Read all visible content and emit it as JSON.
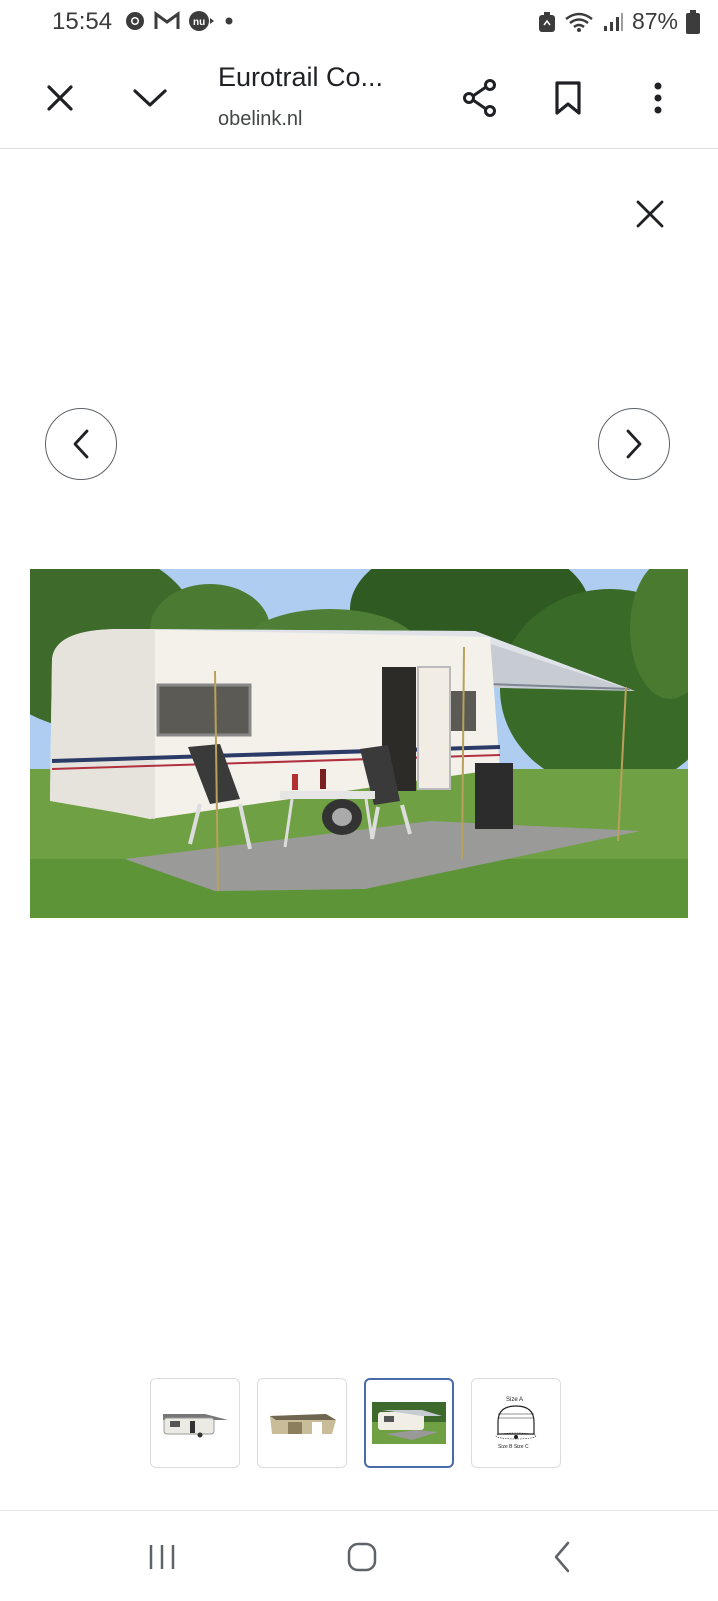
{
  "status_bar": {
    "time": "15:54",
    "battery": "87%",
    "icons_left": [
      "chrome-icon",
      "gmail-icon",
      "nu-icon",
      "dot-icon"
    ],
    "icons_right": [
      "recycle-icon",
      "wifi-icon",
      "signal-icon",
      "battery-icon"
    ]
  },
  "toolbar": {
    "title": "Eurotrail Co...",
    "domain": "obelink.nl",
    "icons": [
      "close-icon",
      "chevron-down-icon",
      "share-icon",
      "bookmark-icon",
      "more-vert-icon"
    ]
  },
  "viewer": {
    "main_image_alt": "Caravan with awning on grass",
    "thumbnails": [
      {
        "name": "caravan-awning-side",
        "selected": false
      },
      {
        "name": "awning-tent",
        "selected": false
      },
      {
        "name": "caravan-field",
        "selected": true
      },
      {
        "name": "size-diagram",
        "selected": false,
        "label_top": "Size A",
        "label_bottom": "Size B  Size C"
      }
    ]
  },
  "colors": {
    "selected_thumb_border": "#4a6aa8",
    "icon_color": "#202124"
  }
}
